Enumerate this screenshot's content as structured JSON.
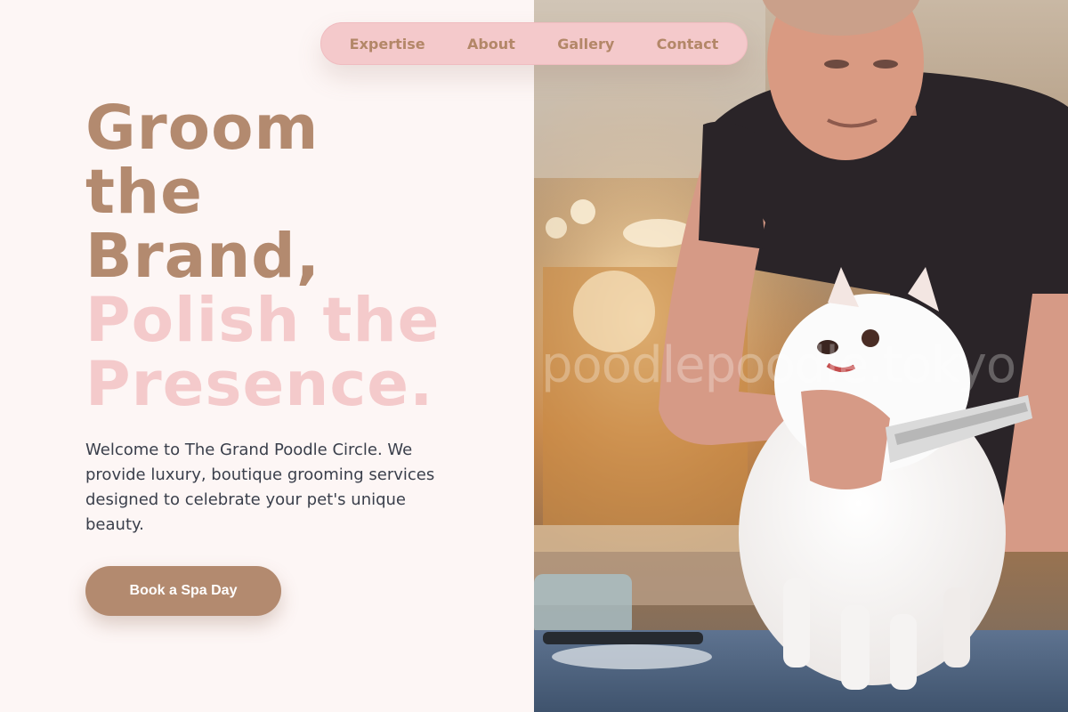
{
  "nav": {
    "items": [
      {
        "label": "Expertise"
      },
      {
        "label": "About"
      },
      {
        "label": "Gallery"
      },
      {
        "label": "Contact"
      }
    ]
  },
  "hero": {
    "headline_lines": [
      "Groom",
      "the",
      "Brand,",
      "Polish the",
      "Presence."
    ],
    "intro": "Welcome to The Grand Poodle Circle. We provide luxury, boutique grooming services designed to celebrate your pet's unique beauty.",
    "cta_label": "Book a Spa Day",
    "watermark": "poodlepoodle.tokyo"
  },
  "colors": {
    "background": "#fdf6f5",
    "nav_bg": "#f4c9cb",
    "brand_brown": "#b38a6f",
    "accent_pink": "#f4cacb",
    "body_text": "#3a3f4b"
  },
  "icons": {
    "photo": "groomer-combing-white-pomeranian-photo"
  }
}
